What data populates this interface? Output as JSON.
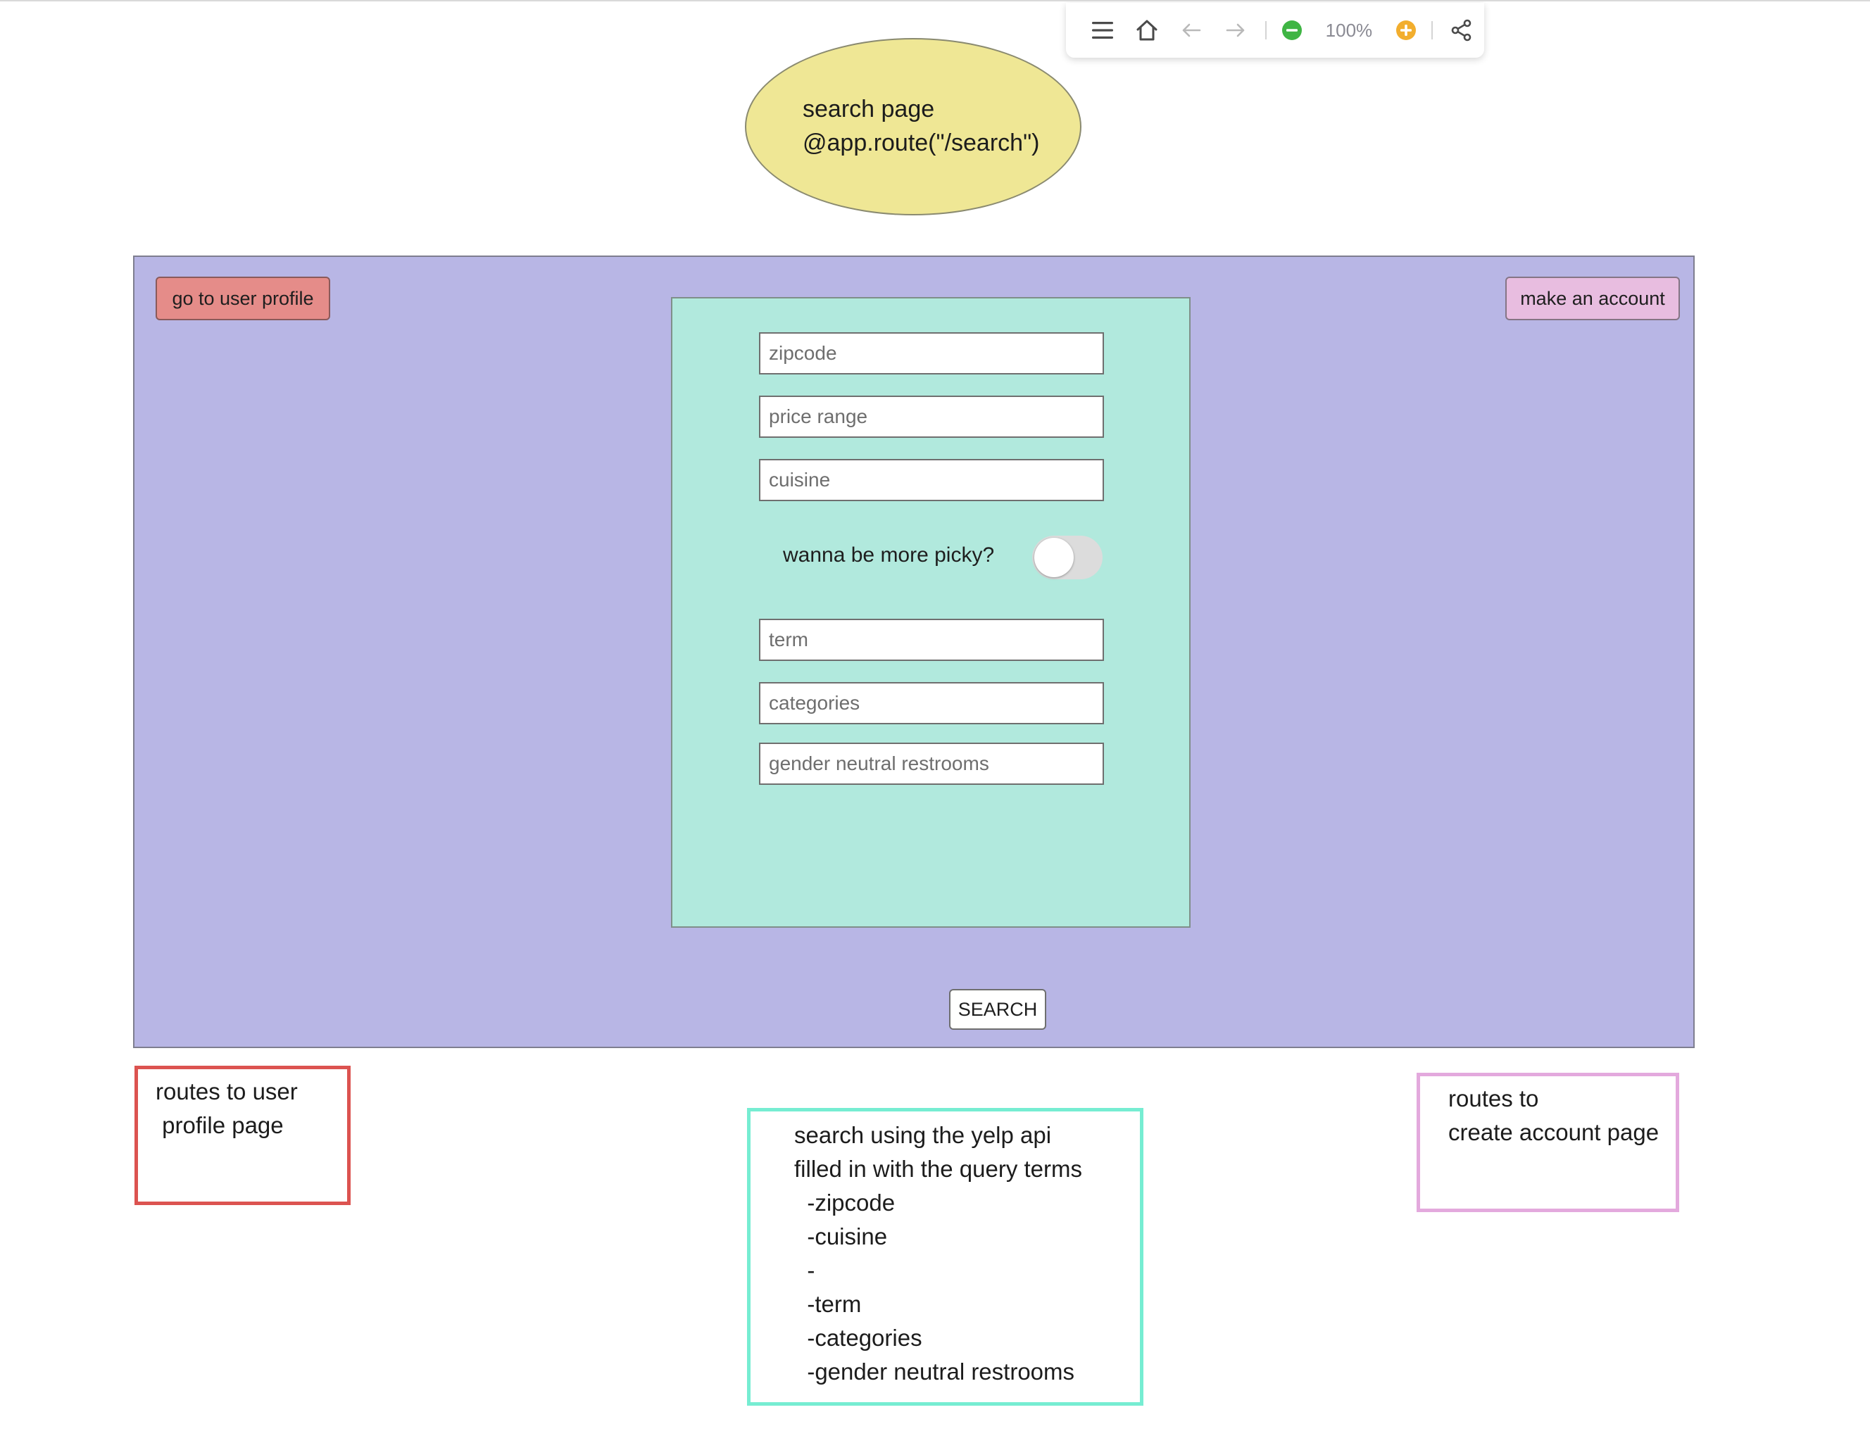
{
  "toolbar": {
    "zoom": "100%",
    "icons": [
      "menu-icon",
      "home-icon",
      "back-arrow-icon",
      "forward-arrow-icon",
      "zoom-out-icon",
      "zoom-in-icon",
      "share-icon"
    ]
  },
  "title": {
    "line1": "search page",
    "line2": "@app.route(\"/search\")"
  },
  "page": {
    "profile_button": "go to user profile",
    "account_button": "make an account",
    "search_button": "SEARCH",
    "fields": {
      "zipcode": "zipcode",
      "price_range": "price range",
      "cuisine": "cuisine",
      "term": "term",
      "categories": "categories",
      "gender_neutral": "gender neutral restrooms"
    },
    "picky_label": "wanna be more picky?",
    "picky_toggle_on": false
  },
  "notes": {
    "profile": "routes to user\n profile page",
    "search": "search using the yelp api\nfilled in with the query terms\n  -zipcode\n  -cuisine\n  -\n  -term\n  -categories\n  -gender neutral restrooms",
    "account": "routes to\ncreate account page"
  },
  "colors": {
    "frame": "#b8b6e5",
    "form_panel": "#b1e9dd",
    "title_ellipse": "#efe795",
    "profile_button": "#e58c89",
    "account_button": "#e8bde0",
    "note_profile_border": "#dc5350",
    "note_search_border": "#76edd2",
    "note_account_border": "#e3a9dd",
    "zoom_out": "#3fb544",
    "zoom_in": "#f2ae2e"
  }
}
